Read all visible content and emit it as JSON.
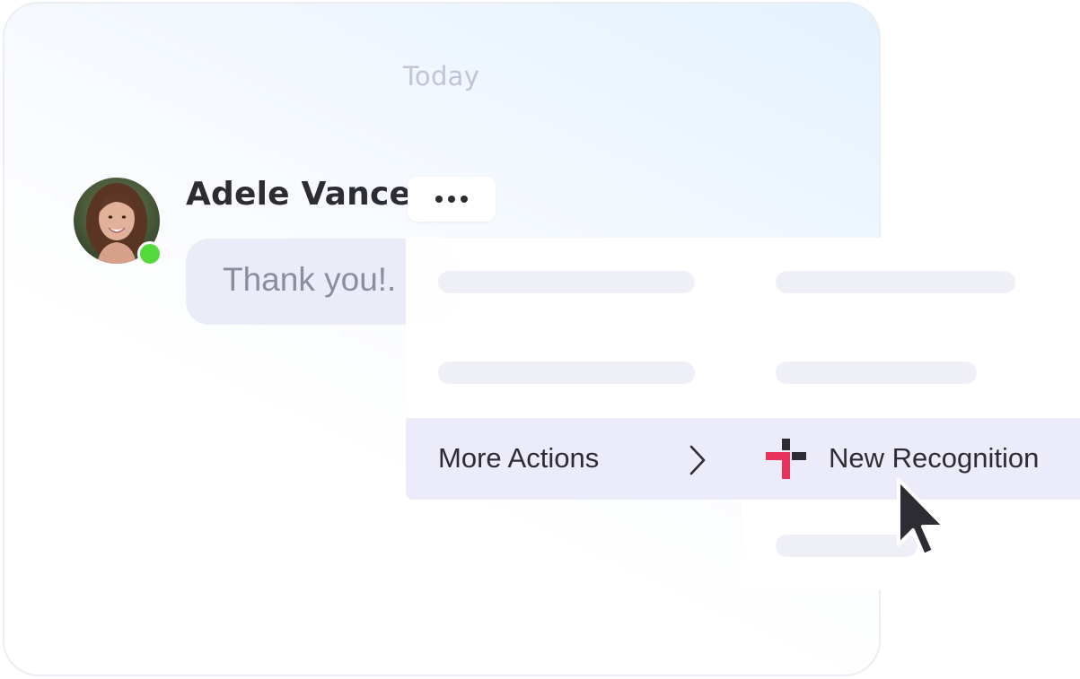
{
  "chat": {
    "date_separator": "Today",
    "message": {
      "sender": "Adele Vance",
      "text": "Thank you!.",
      "presence_color": "#54d93c"
    },
    "more_options_icon": "ellipsis-icon"
  },
  "context_menu": {
    "highlighted_item": {
      "label": "More Actions",
      "icon": "chevron-right-icon"
    },
    "submenu_item": {
      "label": "New Recognition",
      "icon": "recognition-cross-icon",
      "icon_colors": [
        "#e8315a",
        "#2c2c32"
      ]
    }
  },
  "cursor_icon": "pointer-arrow-icon",
  "colors": {
    "text_primary": "#2c2c32",
    "bubble_bg": "#ececf8",
    "highlight_bg": "#ebebfa",
    "skeleton": "#efeff7"
  }
}
